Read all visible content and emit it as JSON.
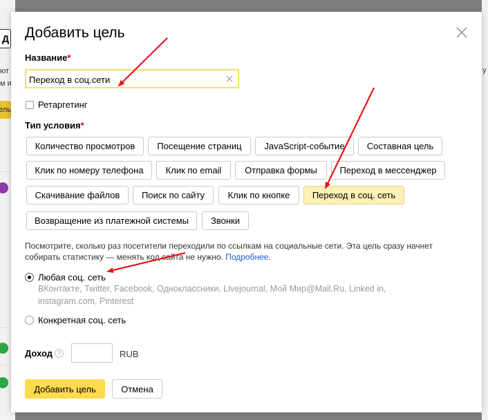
{
  "background": {
    "button_fragment": "Д",
    "text_lines": [
      "ют",
      "м и"
    ],
    "yellow_fragment": "ель",
    "right_fragment": "у"
  },
  "dialog": {
    "title": "Добавить цель",
    "name_label": "Название",
    "required_mark": "*",
    "name_value": "Переход в соц.сети",
    "retargeting_label": "Ретаргетинг",
    "type_label": "Тип условия",
    "condition_types": [
      "Количество просмотров",
      "Посещение страниц",
      "JavaScript-событие",
      "Составная цель",
      "Клик по номеру телефона",
      "Клик по email",
      "Отправка формы",
      "Переход в мессенджер",
      "Скачивание файлов",
      "Поиск по сайту",
      "Клик по кнопке",
      "Переход в соц. сеть",
      "Возвращение из платежной системы",
      "Звонки"
    ],
    "selected_type": "Переход в соц. сеть",
    "description": "Посмотрите, сколько раз посетители переходили по ссылкам на социальные сети. Эта цель сразу начнет собирать статистику — менять код сайта не нужно.",
    "details_link": "Подробнее",
    "details_after": ".",
    "any_network_label": "Любая соц. сеть",
    "any_network_list": "ВКонтакте, Twitter, Facebook, Одноклассники, Livejournal, Мой Мир@Mail.Ru, Linked in, instagram.com, Pinterest",
    "specific_network_label": "Конкретная соц. сеть",
    "income_label": "Доход",
    "income_help": "?",
    "income_value": "",
    "currency": "RUB",
    "submit_label": "Добавить цель",
    "cancel_label": "Отмена"
  },
  "colors": {
    "accent_yellow": "#ffdb4d",
    "selected_type_bg": "#fdf1b6",
    "input_focus_border": "#f5df6c",
    "required": "#d0021b",
    "link": "#1a5bd6",
    "annotation_arrow": "#e8141a"
  },
  "icons": {
    "close": "close-icon",
    "clear": "clear-input-icon",
    "help": "help-icon"
  }
}
